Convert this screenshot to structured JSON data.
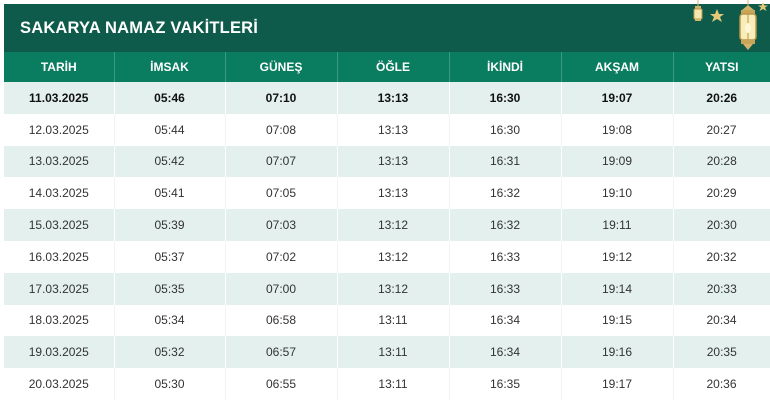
{
  "title": "SAKARYA NAMAZ VAKİTLERİ",
  "colors": {
    "title_bg": "#0f5b4b",
    "header_bg": "#0a7c60",
    "row_alt": "#e3f0ee",
    "lantern": "#d4b36a"
  },
  "decoration": {
    "icons": [
      "star-icon",
      "lantern-icon"
    ]
  },
  "columns": [
    "TARİH",
    "İMSAK",
    "GÜNEŞ",
    "ÖĞLE",
    "İKİNDİ",
    "AKŞAM",
    "YATSI"
  ],
  "rows": [
    [
      "11.03.2025",
      "05:46",
      "07:10",
      "13:13",
      "16:30",
      "19:07",
      "20:26"
    ],
    [
      "12.03.2025",
      "05:44",
      "07:08",
      "13:13",
      "16:30",
      "19:08",
      "20:27"
    ],
    [
      "13.03.2025",
      "05:42",
      "07:07",
      "13:13",
      "16:31",
      "19:09",
      "20:28"
    ],
    [
      "14.03.2025",
      "05:41",
      "07:05",
      "13:13",
      "16:32",
      "19:10",
      "20:29"
    ],
    [
      "15.03.2025",
      "05:39",
      "07:03",
      "13:12",
      "16:32",
      "19:11",
      "20:30"
    ],
    [
      "16.03.2025",
      "05:37",
      "07:02",
      "13:12",
      "16:33",
      "19:12",
      "20:32"
    ],
    [
      "17.03.2025",
      "05:35",
      "07:00",
      "13:12",
      "16:33",
      "19:14",
      "20:33"
    ],
    [
      "18.03.2025",
      "05:34",
      "06:58",
      "13:11",
      "16:34",
      "19:15",
      "20:34"
    ],
    [
      "19.03.2025",
      "05:32",
      "06:57",
      "13:11",
      "16:34",
      "19:16",
      "20:35"
    ],
    [
      "20.03.2025",
      "05:30",
      "06:55",
      "13:11",
      "16:35",
      "19:17",
      "20:36"
    ]
  ]
}
